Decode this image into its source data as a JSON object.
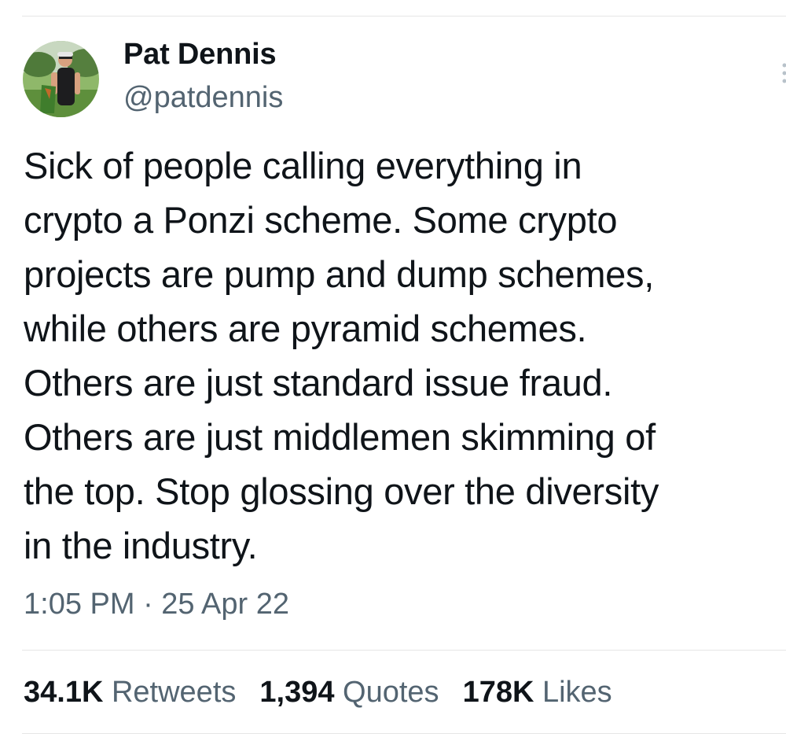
{
  "author": {
    "display_name": "Pat Dennis",
    "handle": "@patdennis",
    "avatar_icon": "profile-photo"
  },
  "tweet": {
    "lines": [
      "Sick of people calling everything in",
      "crypto a Ponzi scheme. Some crypto",
      "projects are pump and dump schemes,",
      "while others are pyramid schemes.",
      "Others are just standard issue fraud.",
      "Others are just middlemen skimming of",
      "the top. Stop glossing over the diversity",
      "in the industry."
    ],
    "timestamp": "1:05 PM · 25 Apr 22"
  },
  "stats": {
    "retweets": {
      "count": "34.1K",
      "label": "Retweets"
    },
    "quotes": {
      "count": "1,394",
      "label": "Quotes"
    },
    "likes": {
      "count": "178K",
      "label": "Likes"
    }
  },
  "colors": {
    "text_primary": "#0f1419",
    "text_secondary": "#536471",
    "divider": "#e6e6e6"
  }
}
